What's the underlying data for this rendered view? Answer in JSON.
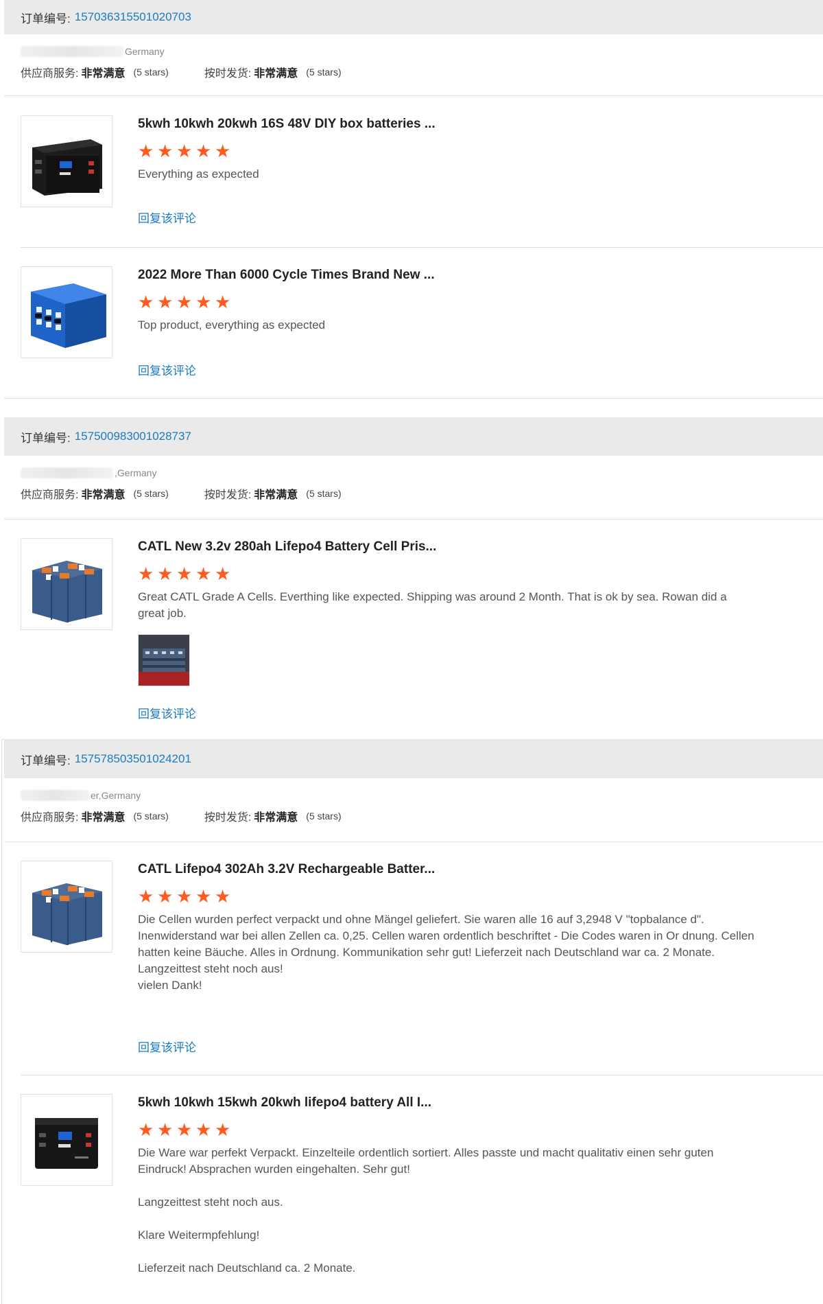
{
  "orders": [
    {
      "label": "订单编号:",
      "order_id": "157036315501020703",
      "buyer": "Germany",
      "supplier_service_label": "供应商服务:",
      "supplier_service_value": "非常满意",
      "supplier_service_stars": "(5 stars)",
      "shipping_label": "按时发货:",
      "shipping_value": "非常满意",
      "shipping_stars": "(5 stars)",
      "items": [
        {
          "title": "5kwh 10kwh 20kwh 16S 48V DIY box batteries ...",
          "rating": 5,
          "review": [
            "Everything as expected"
          ],
          "reply": "回复该评论"
        },
        {
          "title": "2022 More Than 6000 Cycle Times Brand New ...",
          "rating": 5,
          "review": [
            "Top product, everything as expected"
          ],
          "reply": "回复该评论"
        }
      ]
    },
    {
      "label": "订单编号:",
      "order_id": "157500983001028737",
      "buyer": ",Germany",
      "supplier_service_label": "供应商服务:",
      "supplier_service_value": "非常满意",
      "supplier_service_stars": "(5 stars)",
      "shipping_label": "按时发货:",
      "shipping_value": "非常满意",
      "shipping_stars": "(5 stars)",
      "items": [
        {
          "title": "CATL New 3.2v 280ah Lifepo4 Battery Cell Pris...",
          "rating": 5,
          "review": [
            "Great CATL Grade A Cells. Everthing like expected. Shipping was around 2 Month. That is ok by sea. Rowan did a great job."
          ],
          "reply": "回复该评论"
        }
      ]
    },
    {
      "label": "订单编号:",
      "order_id": "157578503501024201",
      "buyer": "er,Germany",
      "supplier_service_label": "供应商服务:",
      "supplier_service_value": "非常满意",
      "supplier_service_stars": "(5 stars)",
      "shipping_label": "按时发货:",
      "shipping_value": "非常满意",
      "shipping_stars": "(5 stars)",
      "items": [
        {
          "title": "CATL Lifepo4 302Ah 3.2V Rechargeable Batter...",
          "rating": 5,
          "review": [
            "Die Cellen wurden perfect verpackt und ohne Mängel geliefert. Sie waren alle 16 auf 3,2948 V \"topbalance d\". Inenwiderstand war bei allen Zellen ca. 0,25. Cellen waren ordentlich beschriftet - Die Codes waren in Or dnung. Cellen hatten keine Bäuche. Alles in Ordnung. Kommunikation sehr gut! Lieferzeit nach Deutschland war ca. 2 Monate.",
            "Langzeittest steht noch aus!",
            "vielen Dank!"
          ],
          "reply": "回复该评论"
        },
        {
          "title": "5kwh 10kwh 15kwh 20kwh lifepo4 battery All I...",
          "rating": 5,
          "review": [
            "Die Ware war perfekt Verpackt. Einzelteile ordentlich sortiert. Alles passte und macht qualitativ einen sehr guten Eindruck! Absprachen wurden eingehalten. Sehr gut!",
            "",
            "Langzeittest steht noch aus.",
            "",
            "Klare Weitermpfehlung!",
            "",
            "Lieferzeit nach Deutschland ca. 2 Monate."
          ]
        }
      ]
    }
  ],
  "colors": {
    "link": "#1a7bc0",
    "star": "#ff5a1f",
    "bar": "#eaeaea"
  }
}
